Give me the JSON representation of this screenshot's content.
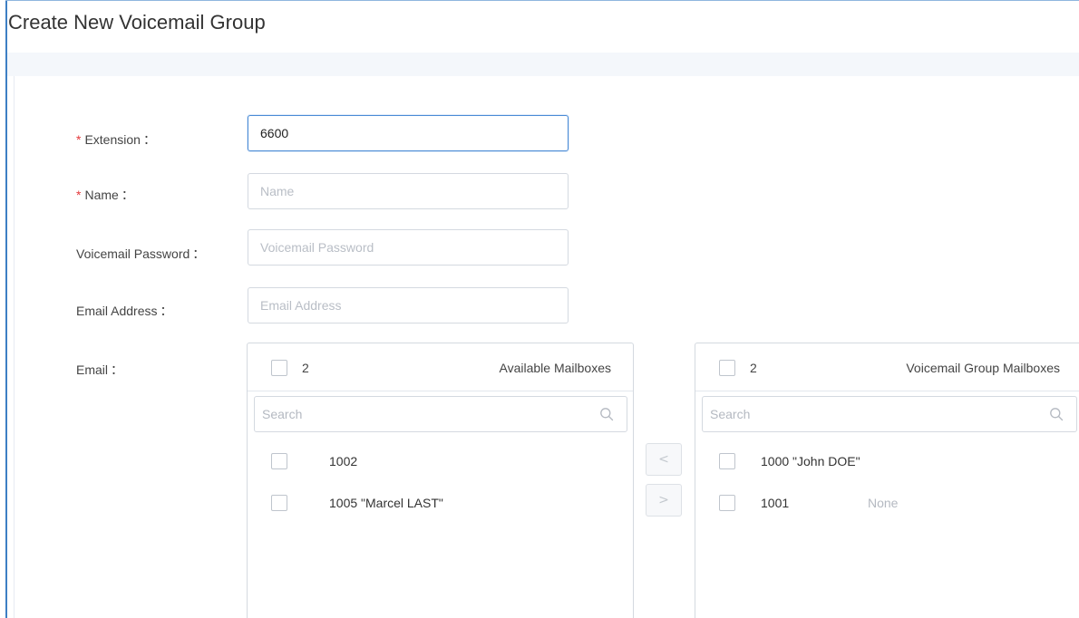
{
  "page": {
    "title": "Create New Voicemail Group"
  },
  "form": {
    "extension": {
      "label": "Extension",
      "required": true,
      "value": "6600",
      "placeholder": ""
    },
    "name": {
      "label": "Name",
      "required": true,
      "value": "",
      "placeholder": "Name"
    },
    "voicemail_password": {
      "label": "Voicemail Password",
      "required": false,
      "value": "",
      "placeholder": "Voicemail Password"
    },
    "email_address": {
      "label": "Email Address",
      "required": false,
      "value": "",
      "placeholder": "Email Address"
    },
    "email": {
      "label": "Email"
    },
    "colon": "："
  },
  "transfer": {
    "available": {
      "title": "Available Mailboxes",
      "count": "2",
      "search_placeholder": "Search",
      "items": [
        {
          "label": "1002",
          "extra": "",
          "checked": false
        },
        {
          "label": "1005 \"Marcel LAST\"",
          "extra": "",
          "checked": false
        }
      ]
    },
    "selected": {
      "title": "Voicemail Group Mailboxes",
      "count": "2",
      "search_placeholder": "Search",
      "items": [
        {
          "label": "1000 \"John DOE\"",
          "extra": "",
          "checked": false
        },
        {
          "label": "1001",
          "extra": "None",
          "checked": false
        }
      ]
    },
    "move_left_label": "<",
    "move_right_label": ">"
  },
  "icons": {
    "required": "asterisk-icon",
    "search": "search-icon",
    "checkbox": "checkbox-icon"
  },
  "colors": {
    "accent": "#4a8bd6",
    "required": "#e4393c",
    "frame": "#3d7fc4",
    "placeholder": "#b9bec6"
  }
}
